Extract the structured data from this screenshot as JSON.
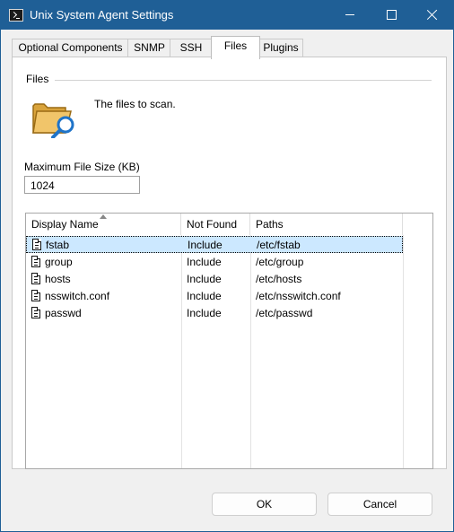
{
  "window": {
    "title": "Unix System Agent Settings"
  },
  "titlebar_buttons": {
    "minimize": "minimize-icon",
    "maximize": "maximize-icon",
    "close": "close-icon"
  },
  "tabs": [
    {
      "label": "Optional Components",
      "active": false
    },
    {
      "label": "SNMP",
      "active": false
    },
    {
      "label": "SSH",
      "active": false
    },
    {
      "label": "Files",
      "active": true
    },
    {
      "label": "Plugins",
      "active": false
    }
  ],
  "files_group": {
    "label": "Files",
    "description": "The files to scan.",
    "icon": "folder-search-icon"
  },
  "max_file_size": {
    "label": "Maximum File Size (KB)",
    "value": "1024"
  },
  "list": {
    "columns": [
      "Display Name",
      "Not Found",
      "Paths"
    ],
    "sort_column": "Display Name",
    "rows": [
      {
        "name": "fstab",
        "not_found": "Include",
        "path": "/etc/fstab",
        "selected": true
      },
      {
        "name": "group",
        "not_found": "Include",
        "path": "/etc/group",
        "selected": false
      },
      {
        "name": "hosts",
        "not_found": "Include",
        "path": "/etc/hosts",
        "selected": false
      },
      {
        "name": "nsswitch.conf",
        "not_found": "Include",
        "path": "/etc/nsswitch.conf",
        "selected": false
      },
      {
        "name": "passwd",
        "not_found": "Include",
        "path": "/etc/passwd",
        "selected": false
      }
    ]
  },
  "buttons": {
    "ok": "OK",
    "cancel": "Cancel"
  },
  "colors": {
    "titlebar": "#1f5f96",
    "selection": "#cce8ff",
    "folder": "#d9a33b",
    "magnifier": "#1f74c9"
  }
}
